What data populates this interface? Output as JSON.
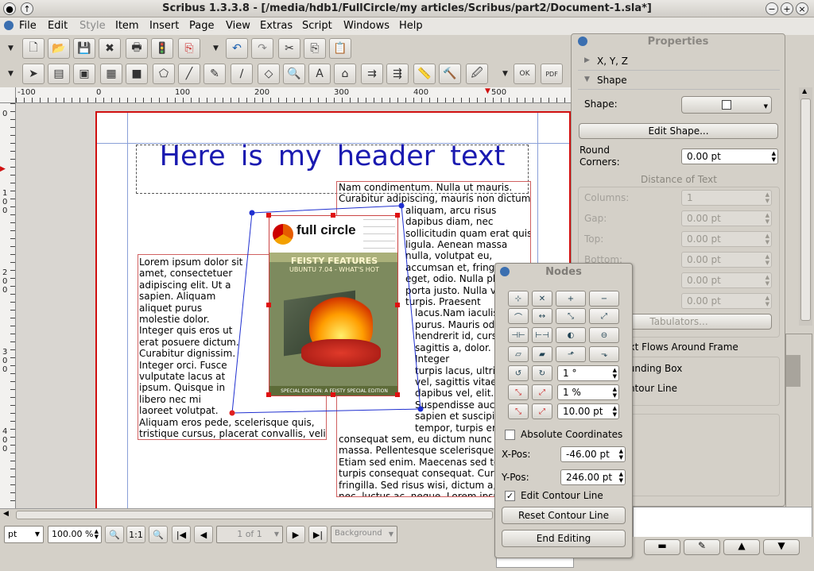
{
  "window": {
    "title": "Scribus 1.3.3.8 - [/media/hdb1/FullCircle/my articles/Scribus/part2/Document-1.sla*]"
  },
  "menu": [
    "File",
    "Edit",
    "Style",
    "Item",
    "Insert",
    "Page",
    "View",
    "Extras",
    "Script",
    "Windows",
    "Help"
  ],
  "menu_disabled": [
    "Style"
  ],
  "ruler": {
    "h_labels": [
      "-100",
      "0",
      "100",
      "200",
      "300",
      "400",
      "500"
    ],
    "v_labels": [
      "0",
      "1\n0\n0",
      "2\n0\n0",
      "3\n0\n0",
      "4\n0\n0"
    ]
  },
  "document": {
    "header_text": "Here is my header text",
    "left_text": [
      "Lorem ipsum dolor sit",
      "amet, consectetuer",
      "adipiscing elit. Ut a",
      "sapien. Aliquam",
      "aliquet purus",
      "molestie dolor.",
      "Integer quis eros ut",
      "erat posuere dictum.",
      "Curabitur dignissim.",
      "Integer orci. Fusce",
      "vulputate lacus at",
      "ipsum. Quisque in",
      "libero nec mi",
      "laoreet volutpat.",
      "Aliquam eros pede, scelerisque quis,",
      "tristique cursus, placerat convallis, velit."
    ],
    "right_text": [
      "Nam condimentum. Nulla ut mauris.",
      "Curabitur adipiscing, mauris non dictum",
      "aliquam, arcu risus",
      "dapibus diam, nec",
      "sollicitudin quam erat quis",
      "ligula. Aenean massa",
      "nulla, volutpat eu,",
      "accumsan et, fringilla",
      "eget, odio. Nulla placerat",
      "porta justo. Nulla vitae",
      "turpis. Praesent",
      "lacus.Nam iaculis",
      "purus. Mauris odio",
      "hendrerit id, cursus",
      "sagittis a, dolor.",
      "Integer",
      "turpis lacus, ultrices",
      "vel, sagittis vitae",
      "dapibus vel, elit.",
      "Suspendisse auctor",
      "sapien et suscipit",
      "tempor, turpis erat",
      "consequat sem, eu dictum nunc lorem",
      "massa. Pellentesque scelerisque pede",
      "Etiam sed enim. Maecenas sed tortor",
      "turpis consequat consequat. Curabitur",
      "fringilla. Sed risus wisi, dictum a,",
      "nec, luctus ac, neque. Lorem ipsum"
    ],
    "image": {
      "logo": "full circle",
      "headline": "FEISTY FEATURES",
      "subline": "UBUNTU 7.04 - WHAT'S HOT",
      "footer": "SPECIAL EDITION: A FEISTY SPECIAL EDITION"
    }
  },
  "statusbar": {
    "unit": "pt",
    "zoom": "100.00 %",
    "one_to_one": "1:1",
    "page": "1 of 1",
    "layer": "Background"
  },
  "properties": {
    "title": "Properties",
    "section_xyz": "X, Y, Z",
    "section_shape": "Shape",
    "shape_label": "Shape:",
    "edit_shape": "Edit Shape...",
    "round_corners_label": "Round\nCorners:",
    "round_corners_value": "0.00 pt",
    "distance_heading": "Distance of Text",
    "columns_label": "Columns:",
    "columns_value": "1",
    "gap_label": "Gap:",
    "gap_value": "0.00 pt",
    "top_label": "Top:",
    "top_value": "0.00 pt",
    "bottom_label": "Bottom:",
    "bottom_value": "0.00 pt",
    "extra_value_1": "0.00 pt",
    "extra_value_2": "0.00 pt",
    "tabulators": "Tabulators...",
    "text_flows": "Text Flows Around Frame",
    "bounding_box": "Use Bounding Box",
    "contour_line": "Use Contour Line"
  },
  "nodes": {
    "title": "Nodes",
    "rotate_value": "1 °",
    "scale_value": "1 %",
    "move_value": "10.00 pt",
    "absolute_coords": "Absolute Coordinates",
    "xpos_label": "X-Pos:",
    "xpos_value": "-46.00 pt",
    "ypos_label": "Y-Pos:",
    "ypos_value": "246.00 pt",
    "edit_contour": "Edit Contour Line",
    "reset_contour": "Reset Contour Line",
    "end_editing": "End Editing"
  }
}
